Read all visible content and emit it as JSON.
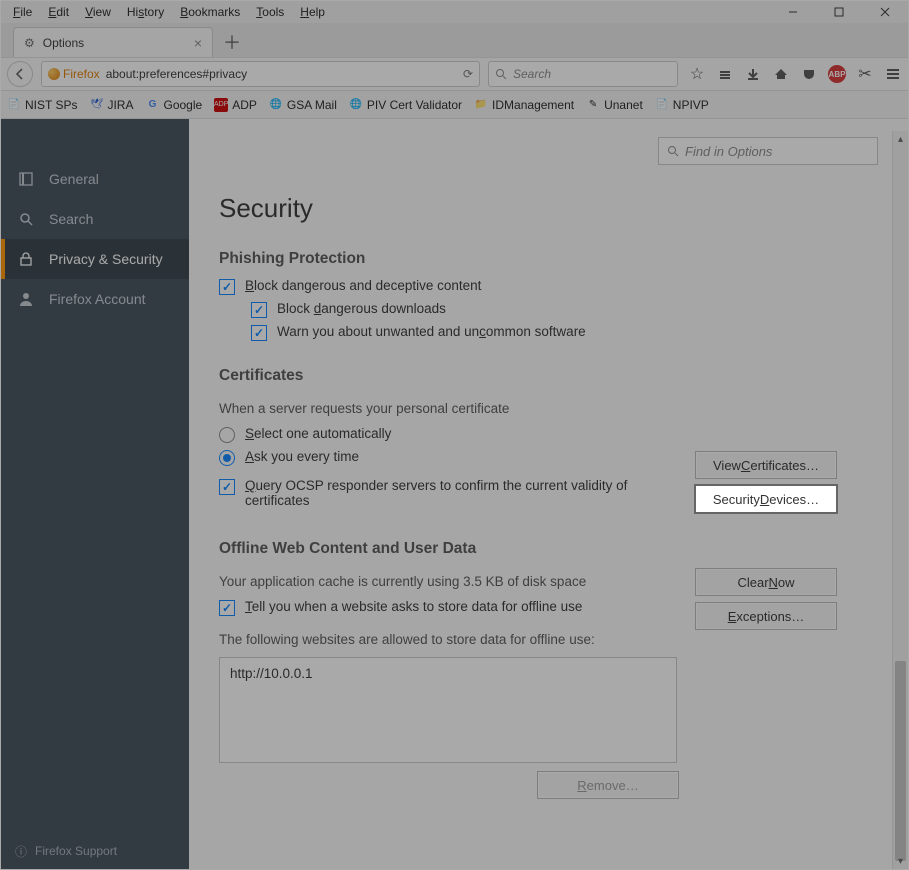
{
  "menubar": {
    "items": [
      "File",
      "Edit",
      "View",
      "History",
      "Bookmarks",
      "Tools",
      "Help"
    ]
  },
  "tab": {
    "title": "Options"
  },
  "url": {
    "brand": "Firefox",
    "value": "about:preferences#privacy"
  },
  "search": {
    "placeholder": "Search"
  },
  "bookmarks": [
    {
      "label": "NIST SPs"
    },
    {
      "label": "JIRA"
    },
    {
      "label": "Google"
    },
    {
      "label": "ADP"
    },
    {
      "label": "GSA Mail"
    },
    {
      "label": "PIV Cert Validator"
    },
    {
      "label": "IDManagement"
    },
    {
      "label": "Unanet"
    },
    {
      "label": "NPIVP"
    }
  ],
  "sidebar": {
    "items": [
      {
        "label": "General"
      },
      {
        "label": "Search"
      },
      {
        "label": "Privacy & Security"
      },
      {
        "label": "Firefox Account"
      }
    ],
    "footer": "Firefox Support"
  },
  "find": {
    "placeholder": "Find in Options"
  },
  "page": {
    "title": "Security",
    "phishing": {
      "heading": "Phishing Protection",
      "opt1": "Block dangerous and deceptive content",
      "opt2": "Block dangerous downloads",
      "opt3": "Warn you about unwanted and uncommon software"
    },
    "certs": {
      "heading": "Certificates",
      "desc": "When a server requests your personal certificate",
      "opt_select": "Select one automatically",
      "opt_ask": "Ask you every time",
      "opt_ocsp": "Query OCSP responder servers to confirm the current validity of certificates",
      "btn_view": "View Certificates…",
      "btn_devices": "Security Devices…"
    },
    "offline": {
      "heading": "Offline Web Content and User Data",
      "usage": "Your application cache is currently using 3.5 KB of disk space",
      "opt_tell": "Tell you when a website asks to store data for offline use",
      "allowed_desc": "The following websites are allowed to store data for offline use:",
      "site": "http://10.0.0.1",
      "btn_clear": "Clear Now",
      "btn_except": "Exceptions…",
      "btn_remove": "Remove…"
    }
  }
}
